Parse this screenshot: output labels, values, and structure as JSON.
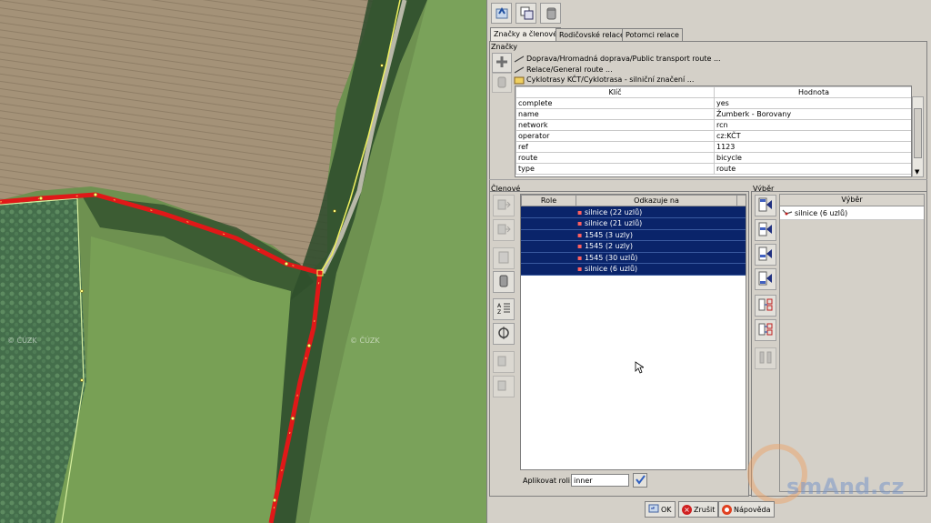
{
  "map": {
    "watermark_left": "© ČÚZK",
    "watermark_right": "© ČÚZK"
  },
  "toolbar": {
    "buttons": [
      "apply-icon",
      "duplicate-icon",
      "delete-icon"
    ]
  },
  "tabs": [
    {
      "label": "Značky a členové",
      "active": true
    },
    {
      "label": "Rodičovské relace",
      "active": false
    },
    {
      "label": "Potomci relace",
      "active": false
    }
  ],
  "tags_section": {
    "title": "Značky",
    "relations": [
      "Doprava/Hromadná doprava/Public transport route ...",
      "Relace/General route ...",
      "Cyklotrasy KČT/Cyklotrasa - silniční značení ..."
    ],
    "columns": {
      "key": "Klíč",
      "value": "Hodnota"
    },
    "rows": [
      {
        "key": "complete",
        "value": "yes"
      },
      {
        "key": "name",
        "value": "Žumberk - Borovany"
      },
      {
        "key": "network",
        "value": "rcn"
      },
      {
        "key": "operator",
        "value": "cz:KČT"
      },
      {
        "key": "ref",
        "value": "1123"
      },
      {
        "key": "route",
        "value": "bicycle"
      },
      {
        "key": "type",
        "value": "route"
      }
    ]
  },
  "members_section": {
    "title": "Členové",
    "columns": {
      "role": "Role",
      "refers": "Odkazuje na"
    },
    "rows": [
      {
        "role": "",
        "refers": "silnice (22 uzlů)"
      },
      {
        "role": "",
        "refers": "silnice (21 uzlů)"
      },
      {
        "role": "",
        "refers": "1545 (3 uzly)"
      },
      {
        "role": "",
        "refers": "1545 (2 uzly)"
      },
      {
        "role": "",
        "refers": "1545 (30 uzlů)"
      },
      {
        "role": "",
        "refers": "silnice (6 uzlů)"
      }
    ],
    "apply_role_label": "Aplikovat roli:",
    "apply_role_value": "inner"
  },
  "selection_section": {
    "title": "Výběr",
    "column": "Výběr",
    "rows": [
      "silnice (6 uzlů)"
    ]
  },
  "bottom_buttons": {
    "ok": "OK",
    "cancel": "Zrušit",
    "help": "Nápověda"
  },
  "watermark": "smAnd.cz",
  "colors": {
    "route": "#e01818",
    "selection": "#0a246a",
    "accent_watermark": "#f0a060"
  }
}
